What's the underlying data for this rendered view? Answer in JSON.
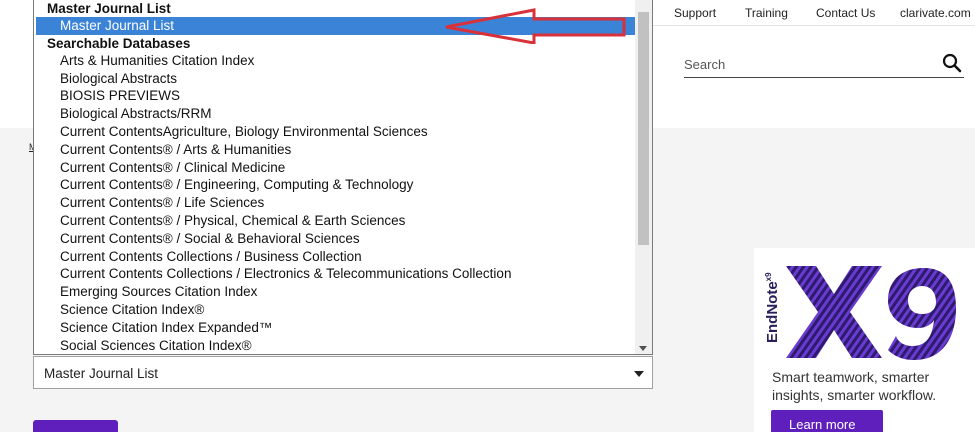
{
  "topnav": {
    "support": "Support",
    "training": "Training",
    "contact": "Contact Us",
    "clarivate": "clarivate.com"
  },
  "search": {
    "placeholder": "Search"
  },
  "breadcrumb_fragment": "M",
  "dropdown": {
    "group1": "Master Journal List",
    "selected_item": "Master Journal List",
    "group2": "Searchable Databases",
    "items": [
      "Arts & Humanities Citation Index",
      "Biological Abstracts",
      "BIOSIS PREVIEWS",
      "Biological Abstracts/RRM",
      "Current ContentsAgriculture, Biology Environmental Sciences",
      "Current Contents® / Arts & Humanities",
      "Current Contents® / Clinical Medicine",
      "Current Contents® / Engineering, Computing & Technology",
      "Current Contents® / Life Sciences",
      "Current Contents® / Physical, Chemical & Earth Sciences",
      "Current Contents® / Social & Behavioral Sciences",
      "Current Contents Collections / Business Collection",
      "Current Contents Collections / Electronics & Telecommunications Collection",
      "Emerging Sources Citation Index",
      "Science Citation Index®",
      "Science Citation Index Expanded™",
      "Social Sciences Citation Index®"
    ]
  },
  "select": {
    "value": "Master Journal List"
  },
  "ad": {
    "brand": "EndNote",
    "version_sup": "x9",
    "tagline_line1": "Smart teamwork, smarter",
    "tagline_line2": "insights, smarter workflow.",
    "cta": "Learn more"
  },
  "colors": {
    "selection": "#3a83d6",
    "brand_purple": "#5e1fbd",
    "annotation_arrow": "#d8313a"
  },
  "icons": {
    "search": "search-icon",
    "caret": "chevron-down-icon",
    "annotation": "arrow-left-icon"
  }
}
